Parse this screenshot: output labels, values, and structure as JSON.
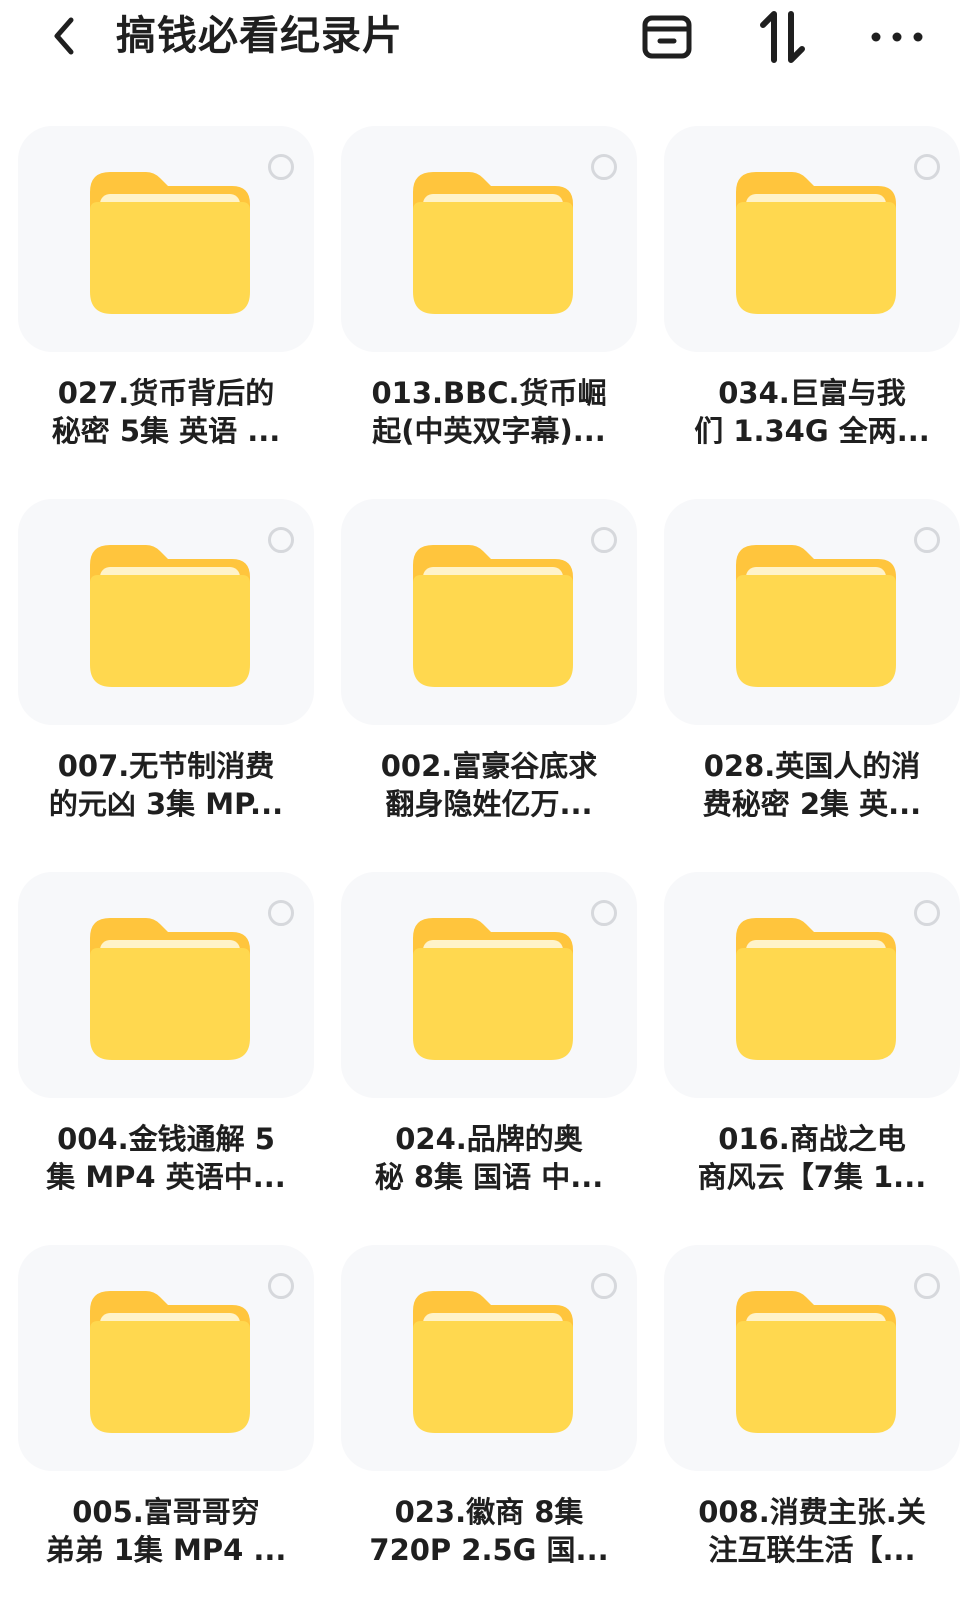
{
  "header": {
    "title": "搞钱必看纪录片",
    "back_icon": "chevron-left-icon",
    "archive_icon": "archive-icon",
    "sort_icon": "sort-icon",
    "more_icon": "more-horizontal-icon"
  },
  "colors": {
    "folder_body": "#ffd84f",
    "folder_tab": "#ffc53d",
    "folder_paper": "#fff3c9",
    "thumb_bg": "#f7f8fa",
    "select_border": "#d6d8dc",
    "text": "#1f1f1f"
  },
  "folders": [
    {
      "line1": "027.货币背后的",
      "line2": "秘密 5集 英语 ..."
    },
    {
      "line1": "013.BBC.货币崛",
      "line2": "起(中英双字幕)..."
    },
    {
      "line1": "034.巨富与我",
      "line2": "们 1.34G 全两..."
    },
    {
      "line1": "007.无节制消费",
      "line2": "的元凶 3集 MP..."
    },
    {
      "line1": "002.富豪谷底求",
      "line2": "翻身隐姓亿万..."
    },
    {
      "line1": "028.英国人的消",
      "line2": "费秘密 2集 英..."
    },
    {
      "line1": "004.金钱通解 5",
      "line2": "集 MP4 英语中..."
    },
    {
      "line1": "024.品牌的奥",
      "line2": "秘 8集 国语 中..."
    },
    {
      "line1": "016.商战之电",
      "line2": "商风云【7集 1..."
    },
    {
      "line1": "005.富哥哥穷",
      "line2": "弟弟 1集 MP4 ..."
    },
    {
      "line1": "023.徽商 8集",
      "line2": "720P 2.5G 国..."
    },
    {
      "line1": "008.消费主张.关",
      "line2": "注互联生活【..."
    }
  ]
}
